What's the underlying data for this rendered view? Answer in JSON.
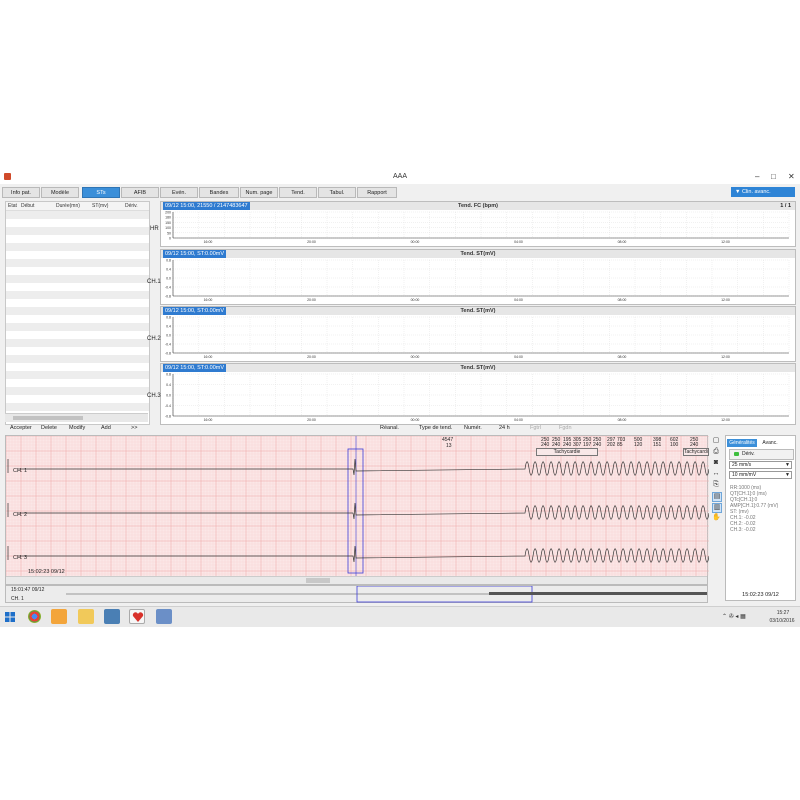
{
  "window": {
    "title": "AAA",
    "min": "–",
    "max": "□",
    "close": "✕"
  },
  "tabs": [
    {
      "label": "Info pat."
    },
    {
      "label": "Modèle"
    },
    {
      "label": "STs"
    },
    {
      "label": "AFIB"
    },
    {
      "label": "Evén."
    },
    {
      "label": "Bandes"
    },
    {
      "label": "Num. page"
    },
    {
      "label": "Tend."
    },
    {
      "label": "Tabul."
    },
    {
      "label": "Rapport"
    }
  ],
  "active_tab": "STs",
  "clin_button": "▼ Clin. avanc.",
  "st_table": {
    "headers": [
      "Etat",
      "Début",
      "Durée(mn)",
      "ST(mv)",
      "Dériv."
    ]
  },
  "trends": [
    {
      "tag": "09/12 15:00, 21550 / 2147483647",
      "title": "Tend. FC (bpm)",
      "label": "HR",
      "page": "1 / 1",
      "y_ticks": [
        "200",
        "180",
        "150",
        "100",
        "50",
        "0"
      ]
    },
    {
      "tag": "09/12 15:00, ST:0.00mV",
      "title": "Tend. ST(mV)",
      "label": "CH.1",
      "y_ticks": [
        "0.8",
        "0.4",
        "0.0",
        "-0.4",
        "-0.8"
      ]
    },
    {
      "tag": "09/12 15:00, ST:0.00mV",
      "title": "Tend. ST(mV)",
      "label": "CH.2",
      "y_ticks": [
        "0.8",
        "0.4",
        "0.0",
        "-0.4",
        "-0.8"
      ]
    },
    {
      "tag": "09/12 15:00, ST:0.00mV",
      "title": "Tend. ST(mV)",
      "label": "CH.3",
      "y_ticks": [
        "0.8",
        "0.4",
        "0.0",
        "-0.4",
        "-0.8"
      ]
    }
  ],
  "time_ticks": [
    "16:00",
    "20:00",
    "00:00",
    "04:00",
    "08:00",
    "12:00"
  ],
  "st_actions": {
    "accept": "Accepter",
    "delete": "Delete",
    "modify": "Modify",
    "add": "Add",
    "more": ">>"
  },
  "trend_controls": {
    "reanal": "Réanal.",
    "type": "Type de tend.",
    "num": "Numér.",
    "h24": "24 h",
    "fgtrl": "Fgtrl",
    "fgdn": "Fgdn"
  },
  "ecg": {
    "hr_top": {
      "value": "4547",
      "sub": "13"
    },
    "hr_values": [
      {
        "top": "250",
        "bottom": "240"
      },
      {
        "top": "250",
        "bottom": "240"
      },
      {
        "top": "195",
        "bottom": "240"
      },
      {
        "top": "305",
        "bottom": "307"
      },
      {
        "top": "250",
        "bottom": "197"
      },
      {
        "top": "250",
        "bottom": "240"
      },
      {
        "top": "297",
        "bottom": "202"
      },
      {
        "top": "703",
        "bottom": "85"
      },
      {
        "top": "500",
        "bottom": "120"
      },
      {
        "top": "398",
        "bottom": "151"
      },
      {
        "top": "602",
        "bottom": "100"
      },
      {
        "top": "250",
        "bottom": "240"
      }
    ],
    "event1": "Tachycardie",
    "event2": "Tachycardie",
    "channels": [
      "CH. 1",
      "CH. 2",
      "CH. 3"
    ],
    "timestamp": "15:02:23 09/12",
    "overview_time": "15:01:47 09/12",
    "overview_channel": "CH. 1"
  },
  "side_panel": {
    "tab1": "Généralités",
    "tab2": "Avanc.",
    "deriv": "Dériv.",
    "speed": "25 mm/s",
    "gain": "10 mm/mV",
    "measures": [
      "RR:1000 (ms)",
      "QT[CH.1]:0 (ms)",
      "QTc[CH.1]:0",
      "AMP[CH.1]:0.77 (mV)",
      "ST: (mv)",
      "CH.1: -0.02",
      "CH.2: -0.02",
      "CH.3: -0.02"
    ],
    "time": "15:02:23 09/12"
  },
  "taskbar": {
    "time": "15:27",
    "date": "03/10/2016"
  },
  "colors": {
    "accent": "#3b8fd9",
    "ecg_bg": "#fbe7e7",
    "ecg_grid": "#f2b9b9",
    "trace": "#333333",
    "cursor": "#3b3bd6"
  }
}
